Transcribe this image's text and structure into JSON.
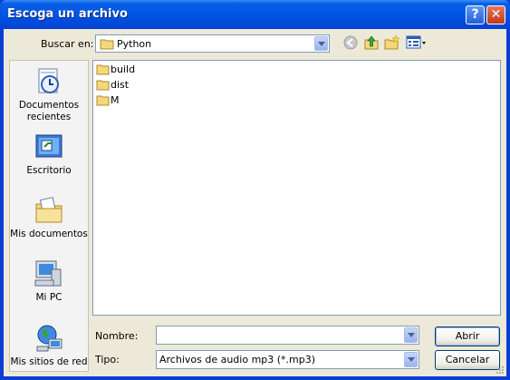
{
  "window": {
    "title": "Escoga un archivo"
  },
  "lookin": {
    "label": "Buscar en:",
    "value": "Python"
  },
  "places": [
    {
      "label": "Documentos recientes",
      "icon": "recent-documents-icon"
    },
    {
      "label": "Escritorio",
      "icon": "desktop-icon"
    },
    {
      "label": "Mis documentos",
      "icon": "my-documents-icon"
    },
    {
      "label": "Mi PC",
      "icon": "my-computer-icon"
    },
    {
      "label": "Mis sitios de red",
      "icon": "network-places-icon"
    }
  ],
  "files": [
    {
      "name": "build",
      "icon": "folder-icon"
    },
    {
      "name": "dist",
      "icon": "folder-icon"
    },
    {
      "name": "M",
      "icon": "folder-icon"
    }
  ],
  "filename": {
    "label": "Nombre:",
    "value": ""
  },
  "filetype": {
    "label": "Tipo:",
    "value": "Archivos de audio mp3 (*.mp3)"
  },
  "buttons": {
    "open": "Abrir",
    "cancel": "Cancelar"
  },
  "colors": {
    "titlebar": "#0055e5",
    "face": "#ece9d8",
    "border": "#7f9db9",
    "close": "#c1391b"
  }
}
